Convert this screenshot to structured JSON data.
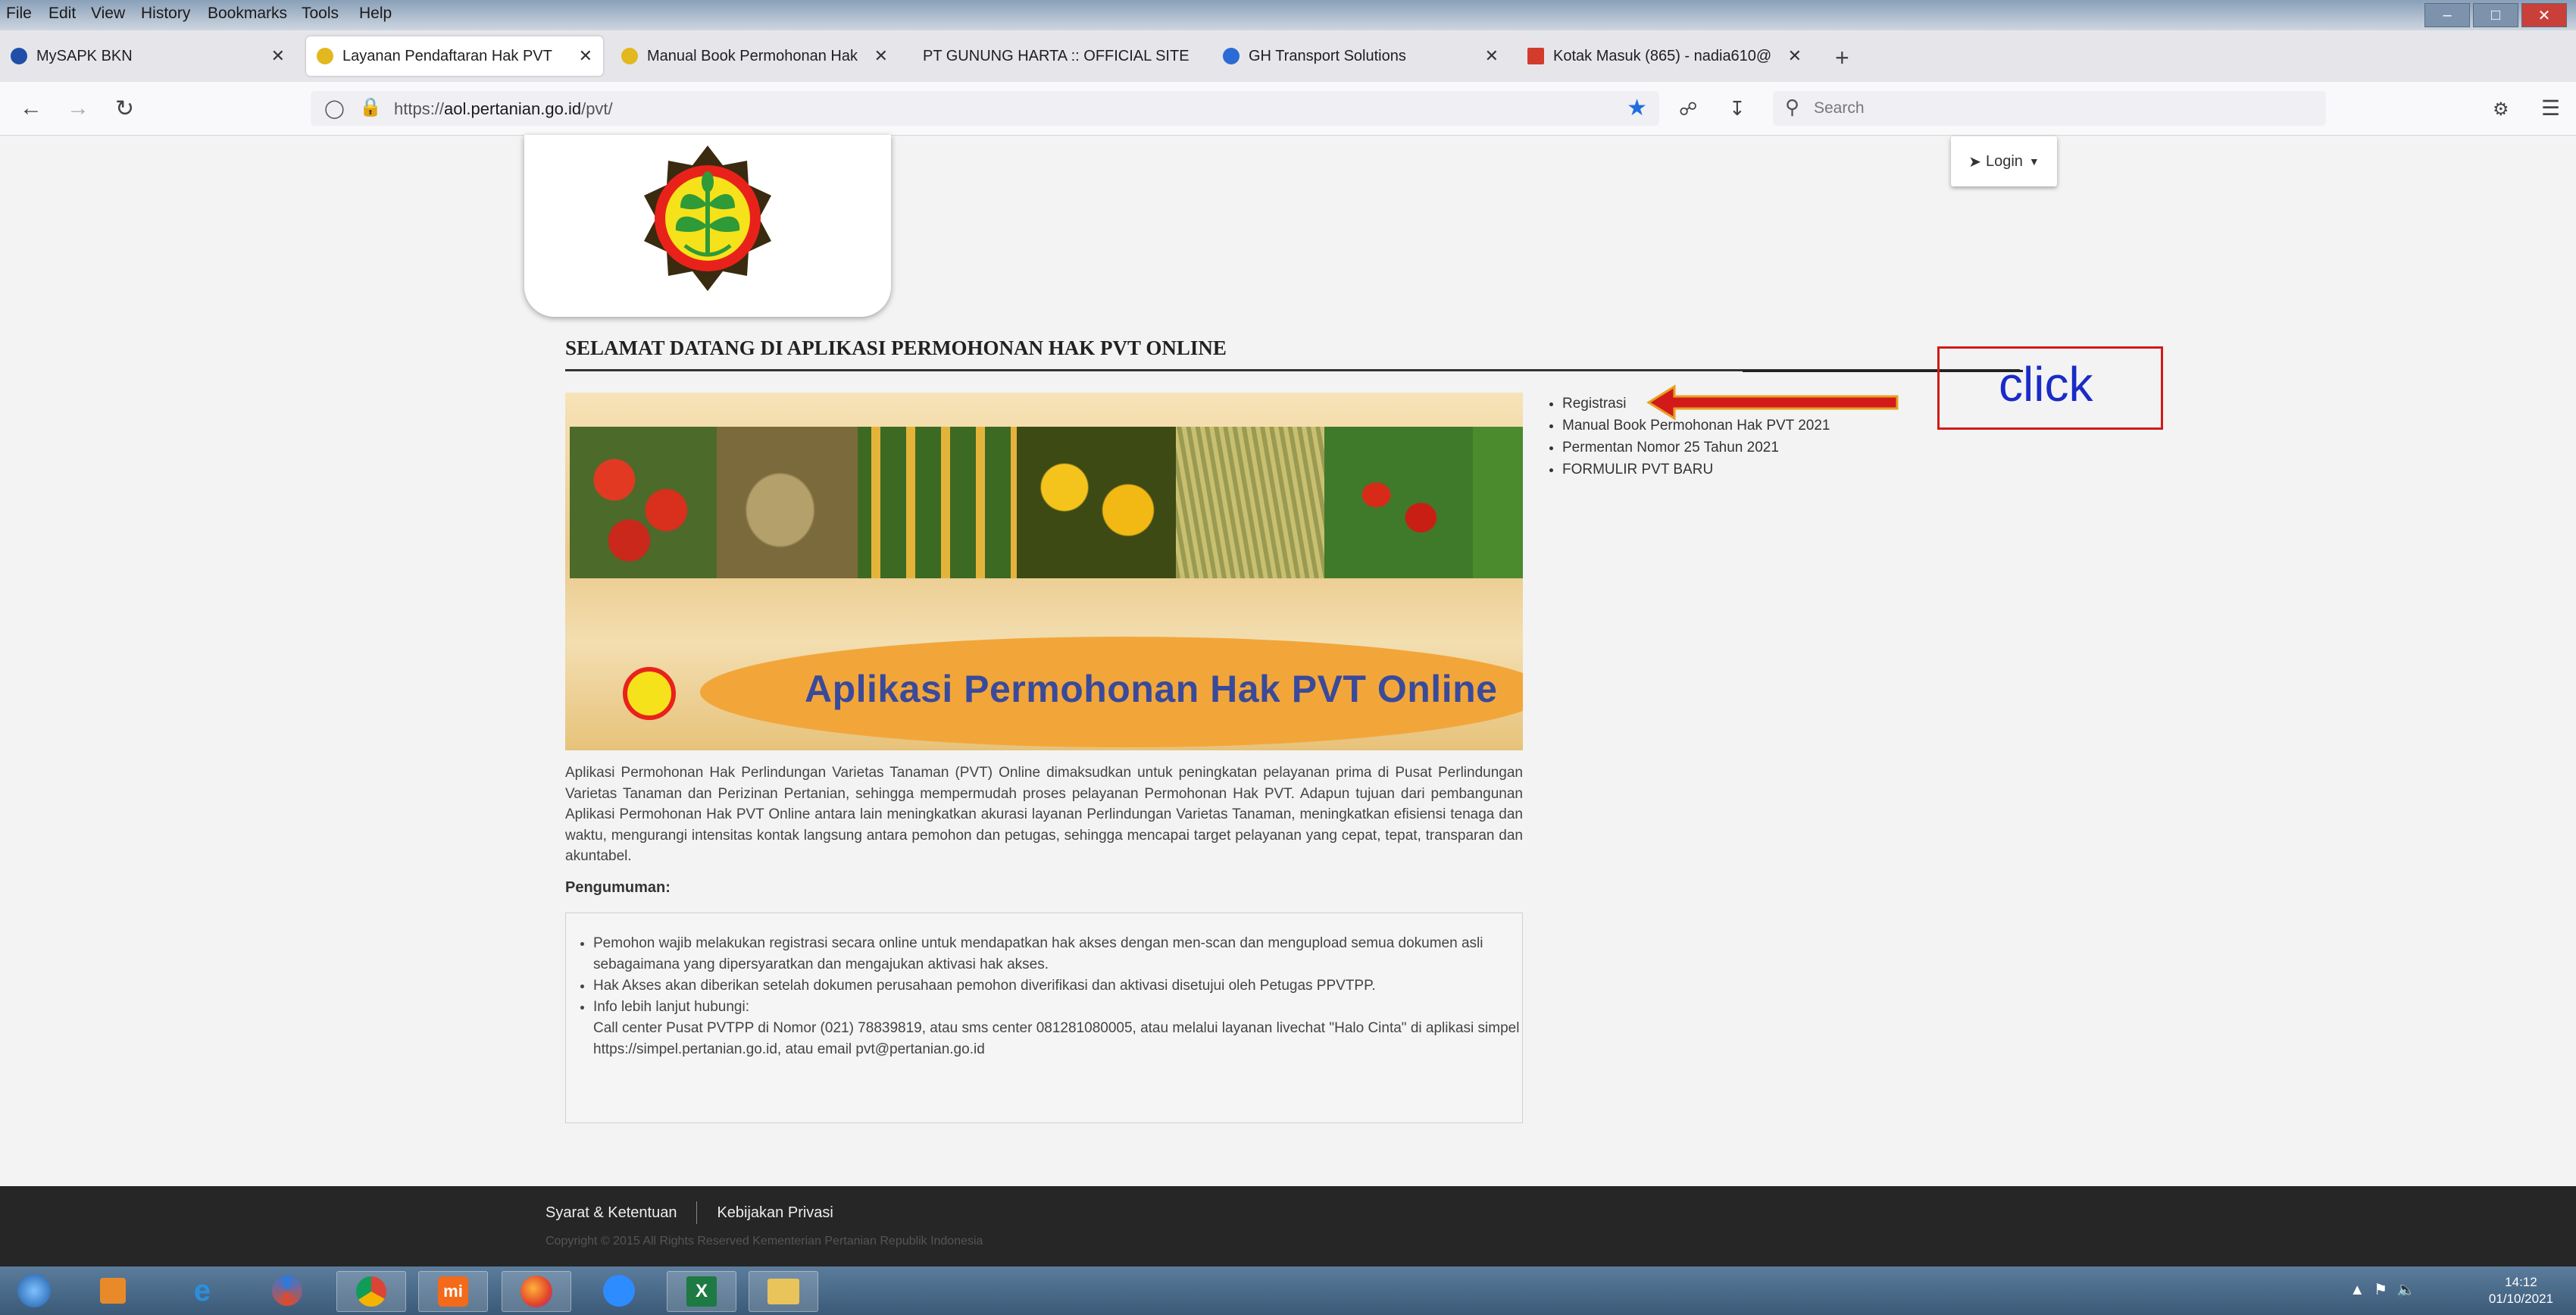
{
  "menubar": {
    "items": [
      "File",
      "Edit",
      "View",
      "History",
      "Bookmarks",
      "Tools",
      "Help"
    ]
  },
  "tabs": [
    {
      "title": "MySAPK BKN",
      "active": false
    },
    {
      "title": "Layanan Pendaftaran Hak PVT",
      "active": true
    },
    {
      "title": "Manual Book Permohonan Hak",
      "active": false
    },
    {
      "title": "PT GUNUNG HARTA :: OFFICIAL SITE",
      "active": false
    },
    {
      "title": "GH Transport Solutions",
      "active": false
    },
    {
      "title": "Kotak Masuk (865) - nadia610@",
      "active": false
    }
  ],
  "address": {
    "url_prefix": "https://",
    "url_host": "aol.pertanian.go.id",
    "url_path": "/pvt/",
    "search_placeholder": "Search"
  },
  "page": {
    "login_label": "Login",
    "welcome": "SELAMAT DATANG DI APLIKASI PERMOHONAN HAK PVT ONLINE",
    "banner_title": "Aplikasi Permohonan Hak PVT Online",
    "intro": "Aplikasi Permohonan Hak Perlindungan Varietas Tanaman (PVT) Online dimaksudkan untuk peningkatan pelayanan prima di Pusat Perlindungan Varietas Tanaman dan Perizinan Pertanian, sehingga mempermudah proses pelayanan Permohonan Hak PVT. Adapun tujuan dari pembangunan Aplikasi Permohonan Hak PVT Online antara lain meningkatkan akurasi layanan Perlindungan Varietas Tanaman, meningkatkan efisiensi tenaga dan waktu, mengurangi intensitas kontak langsung antara pemohon dan petugas, sehingga mencapai target pelayanan yang cepat, tepat, transparan dan akuntabel.",
    "announcement_heading": "Pengumuman:",
    "announcements": [
      "Pemohon wajib melakukan registrasi secara online untuk mendapatkan hak akses dengan men-scan dan mengupload semua dokumen asli sebagaimana yang dipersyaratkan dan mengajukan aktivasi hak akses.",
      "Hak Akses akan diberikan setelah dokumen perusahaan pemohon diverifikasi dan aktivasi disetujui oleh Petugas PPVTPP.",
      "Info lebih lanjut hubungi:",
      "Call center Pusat PVTPP di Nomor (021) 78839819, atau sms center 081281080005, atau melalui layanan livechat \"Halo Cinta\" di aplikasi simpel https://simpel.pertanian.go.id, atau email pvt@pertanian.go.id"
    ],
    "links": [
      "Registrasi",
      "Manual Book Permohonan Hak PVT 2021",
      "Permentan Nomor 25 Tahun 2021",
      "FORMULIR PVT BARU"
    ],
    "annotation": "click"
  },
  "footer": {
    "link1": "Syarat & Ketentuan",
    "link2": "Kebijakan Privasi",
    "copyright": "Copyright © 2015 All Rights Reserved Kementerian Pertanian Republik Indonesia"
  },
  "taskbar": {
    "time": "14:12",
    "date": "01/10/2021"
  },
  "colors": {
    "banner_orange": "#f2a63a",
    "banner_title": "#3a4a9a",
    "annotation_red": "#d21a1a",
    "annotation_text": "#1a2bc8",
    "footer_bg": "#262626"
  }
}
